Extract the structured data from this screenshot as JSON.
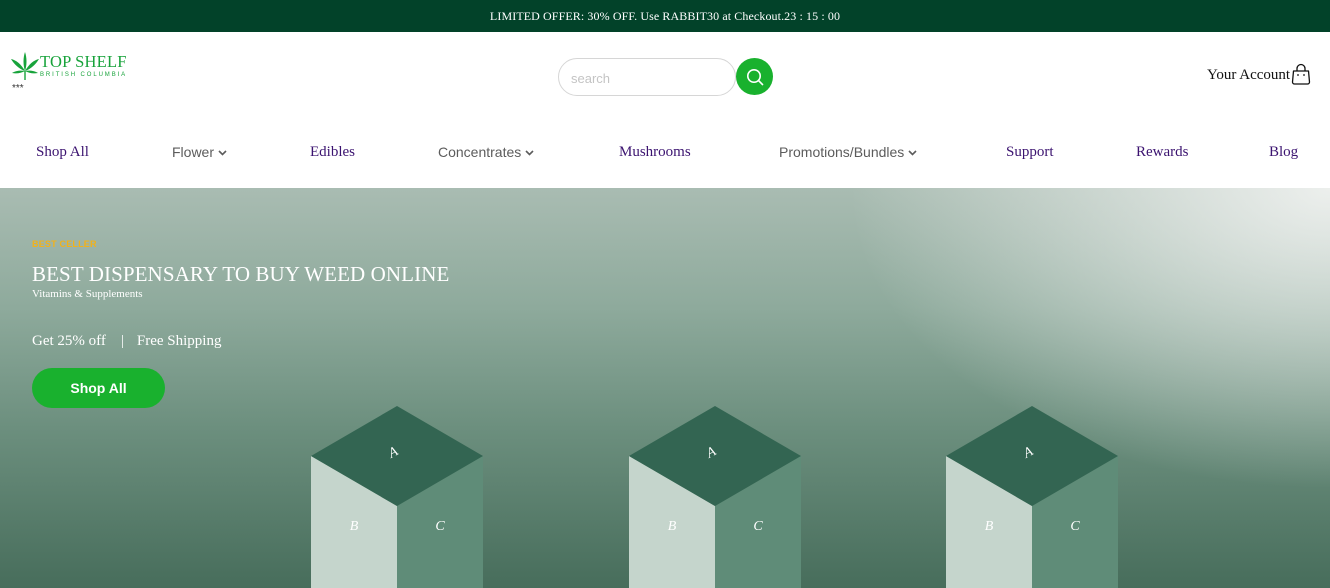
{
  "promo_bar": {
    "text": "LIMITED OFFER: 30% OFF. Use RABBIT30 at Checkout.23 : 15 : 00"
  },
  "logo": {
    "name": "TOP SHELF",
    "subtitle": "BRITISH COLUMBIA",
    "stars": "***"
  },
  "search": {
    "placeholder": "search",
    "value": "",
    "icon": "search-icon"
  },
  "account": {
    "label": "Your Account",
    "icon": "shopping-bag-icon"
  },
  "nav": {
    "items": [
      {
        "label": "Shop All",
        "dropdown": false
      },
      {
        "label": "Flower",
        "dropdown": true
      },
      {
        "label": "Edibles",
        "dropdown": false
      },
      {
        "label": "Concentrates",
        "dropdown": true
      },
      {
        "label": "Mushrooms",
        "dropdown": false
      },
      {
        "label": "Promotions/Bundles",
        "dropdown": true
      },
      {
        "label": "Support",
        "dropdown": false
      },
      {
        "label": "Rewards",
        "dropdown": false
      },
      {
        "label": "Blog",
        "dropdown": false
      }
    ]
  },
  "hero": {
    "tag": "BEST CELLER",
    "title": "BEST DISPENSARY TO BUY WEED ONLINE",
    "subtitle": "Vitamins & Supplements",
    "offer_left": "Get 25% off",
    "offer_sep": "|",
    "offer_right": "Free Shipping",
    "cta_label": "Shop All",
    "boxes": [
      {
        "faces": [
          "A",
          "B",
          "C"
        ]
      },
      {
        "faces": [
          "A",
          "B",
          "C"
        ]
      },
      {
        "faces": [
          "A",
          "B",
          "C"
        ]
      }
    ]
  },
  "colors": {
    "promo_bg": "#024229",
    "brand_green": "#19b12e",
    "nav_purple": "#3b1370",
    "tag_yellow": "#f2b21a"
  }
}
